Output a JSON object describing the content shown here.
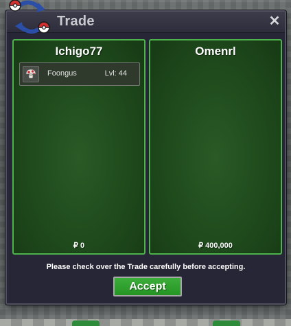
{
  "window": {
    "title": "Trade",
    "close_label": "✕"
  },
  "traders": [
    {
      "name": "Ichigo77",
      "money": "₽ 0",
      "offers": [
        {
          "pokemon": "Foongus",
          "level": "Lvl: 44",
          "icon": "foongus-icon"
        }
      ]
    },
    {
      "name": "Omenrl",
      "money": "₽ 400,000",
      "offers": []
    }
  ],
  "footer": {
    "notice": "Please check over the Trade carefully before accepting.",
    "accept_label": "Accept"
  },
  "colors": {
    "panel_border": "#4fb34d",
    "panel_fill": "#1f4a1c",
    "accept_button": "#2fa02d",
    "window_bg": "#262636"
  }
}
